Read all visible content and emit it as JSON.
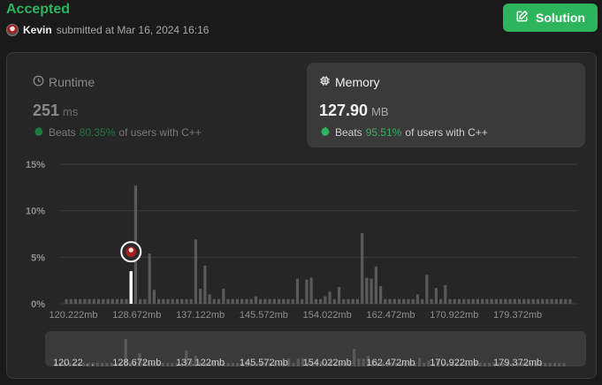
{
  "header": {
    "status": "Accepted",
    "status_color": "#2db55d",
    "submitter": "Kevin",
    "submitted_text": "submitted at Mar 16, 2024 16:16",
    "solution_button": "Solution",
    "solution_icon": "edit-icon"
  },
  "runtime": {
    "label": "Runtime",
    "icon": "clock-icon",
    "value": "251",
    "unit": "ms",
    "beats_label": "Beats",
    "beats_pct": "80.35%",
    "beats_suffix": "of users with C++",
    "selected": false
  },
  "memory": {
    "label": "Memory",
    "icon": "chip-icon",
    "value": "127.90",
    "unit": "MB",
    "beats_label": "Beats",
    "beats_pct": "95.51%",
    "beats_suffix": "of users with C++",
    "selected": true
  },
  "chart_data": {
    "type": "bar",
    "title": "",
    "xlabel": "",
    "ylabel": "",
    "ylim": [
      0,
      15
    ],
    "y_ticks": [
      "0%",
      "5%",
      "10%",
      "15%"
    ],
    "x_ticks": [
      "120.222mb",
      "128.672mb",
      "137.122mb",
      "145.572mb",
      "154.022mb",
      "162.472mb",
      "170.922mb",
      "179.372mb"
    ],
    "mini_x_ticks": [
      "120.22 . .",
      "128.672mb",
      "137.122mb",
      "145.572mb",
      "154.022mb",
      "162.472mb",
      "170.922mb",
      "179.372mb"
    ],
    "values": [
      0.5,
      0.5,
      0.5,
      0.5,
      0.5,
      0.5,
      0.5,
      0.5,
      0.5,
      0.5,
      0.5,
      0.5,
      0.5,
      0.5,
      0.5,
      12.7,
      0.5,
      0.5,
      5.4,
      1.5,
      0.5,
      0.5,
      0.5,
      0.5,
      0.5,
      0.5,
      0.5,
      0.5,
      6.9,
      1.6,
      4.1,
      1.0,
      0.5,
      0.5,
      1.6,
      0.5,
      0.5,
      0.5,
      0.5,
      0.5,
      0.5,
      0.8,
      0.5,
      0.5,
      0.5,
      0.5,
      0.5,
      0.5,
      0.5,
      0.5,
      2.7,
      0.5,
      2.6,
      2.8,
      0.5,
      0.5,
      0.8,
      1.3,
      0.5,
      1.8,
      0.5,
      0.5,
      0.5,
      0.5,
      7.6,
      2.8,
      2.7,
      4.0,
      1.9,
      0.5,
      0.5,
      0.5,
      0.5,
      0.5,
      0.5,
      0.5,
      1.0,
      0.5,
      3.1,
      0.5,
      1.7,
      0.5,
      2.0,
      0.5,
      0.5,
      0.5,
      0.5,
      0.5,
      0.5,
      0.5,
      0.5,
      0.5,
      0.5,
      0.5,
      0.5,
      0.5,
      0.5,
      0.5,
      0.5,
      0.5,
      0.5,
      0.5,
      0.5,
      0.5,
      0.5,
      0.5,
      0.5,
      0.5,
      0.5,
      0.5
    ],
    "user_marker_index": 14,
    "user_marker_value": 3.5,
    "grid": true
  }
}
